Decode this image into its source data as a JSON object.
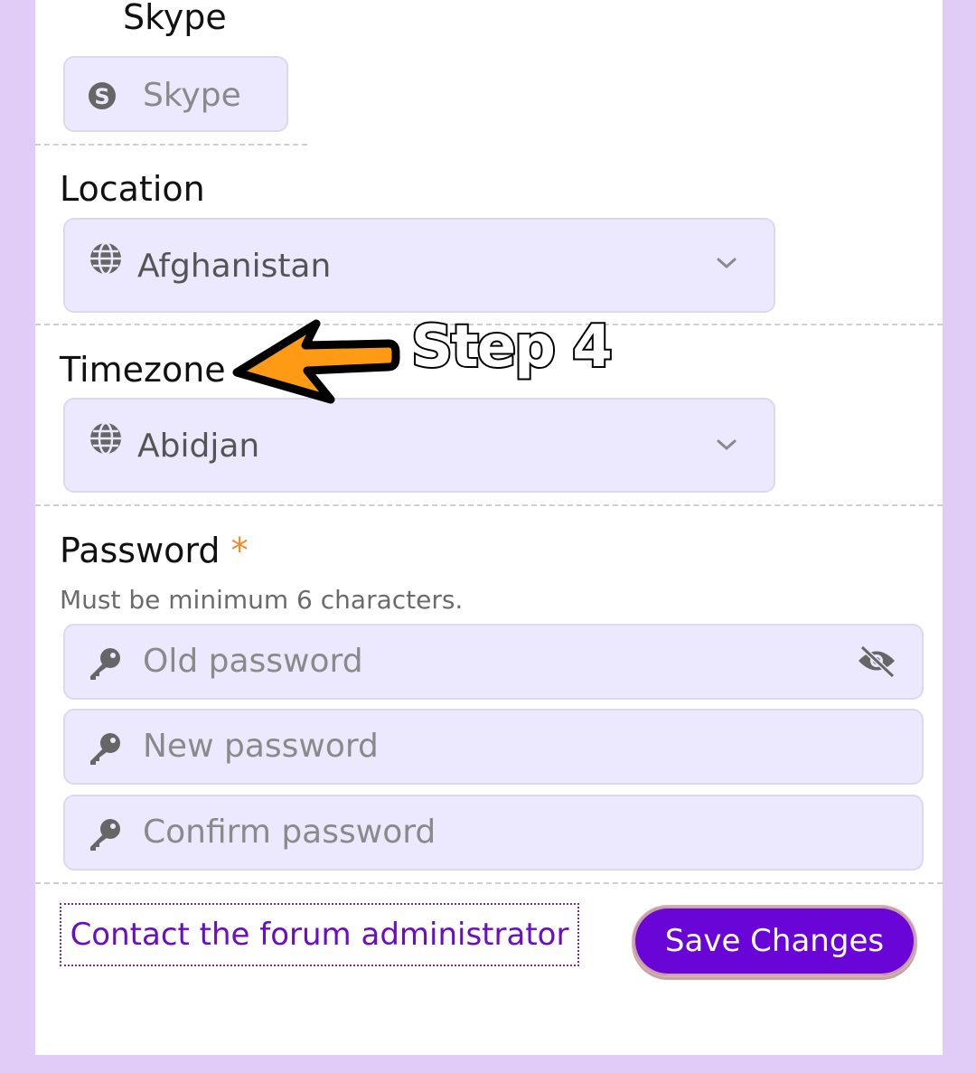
{
  "skype": {
    "label": "Skype",
    "placeholder": "Skype",
    "icon": "skype-icon"
  },
  "location": {
    "label": "Location",
    "value": "Afghanistan",
    "icon": "globe-icon"
  },
  "timezone": {
    "label": "Timezone",
    "value": "Abidjan",
    "icon": "globe-icon"
  },
  "password": {
    "label": "Password",
    "required_mark": "*",
    "hint": "Must be minimum 6 characters.",
    "old_placeholder": "Old password",
    "new_placeholder": "New password",
    "confirm_placeholder": "Confirm password"
  },
  "annotation": {
    "text": "Step 4",
    "arrow_color": "#ff9a14"
  },
  "actions": {
    "contact_label": "Contact the forum administrator",
    "save_label": "Save Changes"
  },
  "colors": {
    "page_background": "#e0ccf6",
    "field_background": "#ece8fd",
    "accent": "#6a05d8",
    "required": "#f08a2a"
  }
}
